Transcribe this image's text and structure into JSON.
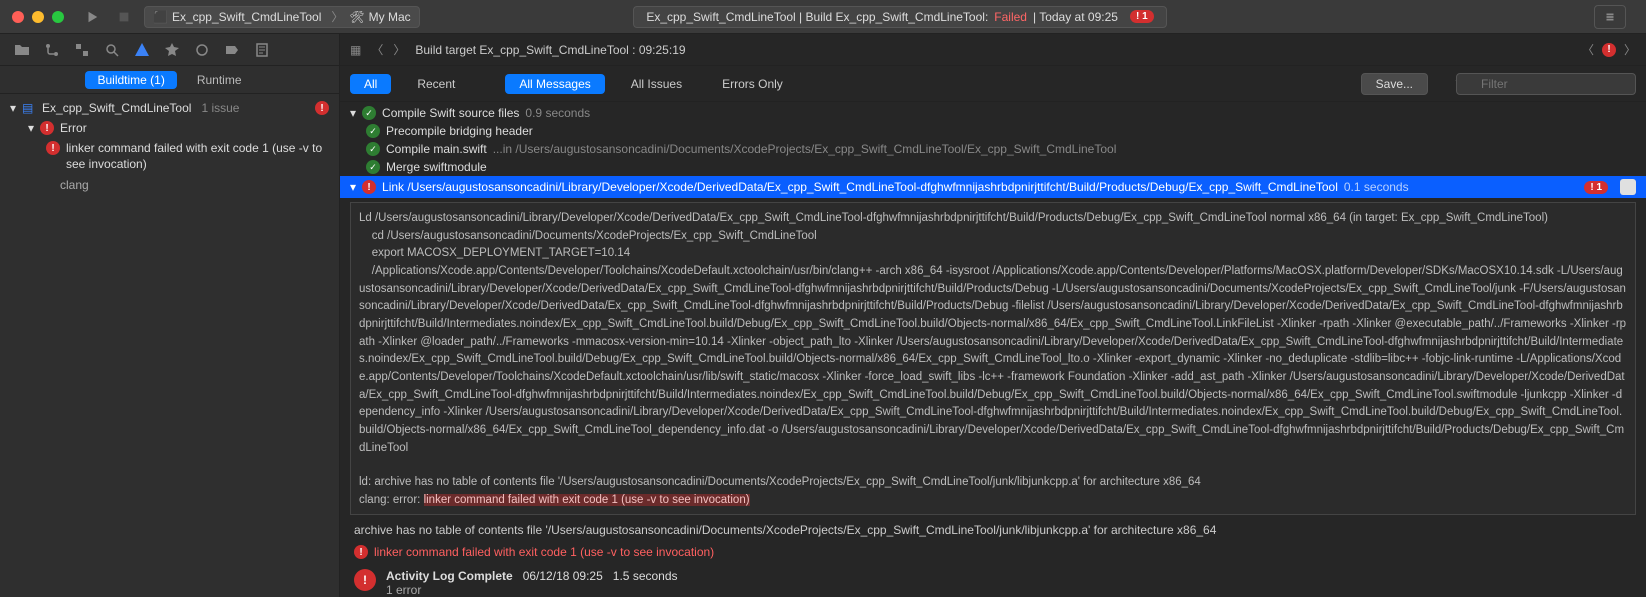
{
  "titlebar": {
    "scheme_app": "Ex_cpp_Swift_CmdLineTool",
    "scheme_dest": "My Mac",
    "status_prefix": "Ex_cpp_Swift_CmdLineTool | Build Ex_cpp_Swift_CmdLineTool:",
    "status_result": "Failed",
    "status_time": "| Today at 09:25",
    "error_count": "1"
  },
  "left": {
    "tab_buildtime": "Buildtime (1)",
    "tab_runtime": "Runtime",
    "project": "Ex_cpp_Swift_CmdLineTool",
    "issue_suffix": "1 issue",
    "error_label": "Error",
    "linker_msg": "linker command failed with exit code 1 (use -v to see invocation)",
    "clang": "clang"
  },
  "crumbs": {
    "target": "Build target Ex_cpp_Swift_CmdLineTool : 09:25:19"
  },
  "filters": {
    "all": "All",
    "recent": "Recent",
    "all_messages": "All Messages",
    "all_issues": "All Issues",
    "errors_only": "Errors Only",
    "save": "Save...",
    "filter_ph": "Filter"
  },
  "log": {
    "compile_header": "Compile Swift source files",
    "compile_time": "0.9 seconds",
    "precompile": "Precompile bridging header",
    "compile_main": "Compile main.swift",
    "compile_main_path": "...in /Users/augustosansoncadini/Documents/XcodeProjects/Ex_cpp_Swift_CmdLineTool/Ex_cpp_Swift_CmdLineTool",
    "merge": "Merge swiftmodule",
    "link_header": "Link /Users/augustosansoncadini/Library/Developer/Xcode/DerivedData/Ex_cpp_Swift_CmdLineTool-dfghwfmnijashrbdpnirjttifcht/Build/Products/Debug/Ex_cpp_Swift_CmdLineTool",
    "link_time": "0.1 seconds",
    "err_badge": "1",
    "code_body": "Ld /Users/augustosansoncadini/Library/Developer/Xcode/DerivedData/Ex_cpp_Swift_CmdLineTool-dfghwfmnijashrbdpnirjttifcht/Build/Products/Debug/Ex_cpp_Swift_CmdLineTool normal x86_64 (in target: Ex_cpp_Swift_CmdLineTool)\n    cd /Users/augustosansoncadini/Documents/XcodeProjects/Ex_cpp_Swift_CmdLineTool\n    export MACOSX_DEPLOYMENT_TARGET=10.14\n    /Applications/Xcode.app/Contents/Developer/Toolchains/XcodeDefault.xctoolchain/usr/bin/clang++ -arch x86_64 -isysroot /Applications/Xcode.app/Contents/Developer/Platforms/MacOSX.platform/Developer/SDKs/MacOSX10.14.sdk -L/Users/augustosansoncadini/Library/Developer/Xcode/DerivedData/Ex_cpp_Swift_CmdLineTool-dfghwfmnijashrbdpnirjttifcht/Build/Products/Debug -L/Users/augustosansoncadini/Documents/XcodeProjects/Ex_cpp_Swift_CmdLineTool/junk -F/Users/augustosansoncadini/Library/Developer/Xcode/DerivedData/Ex_cpp_Swift_CmdLineTool-dfghwfmnijashrbdpnirjttifcht/Build/Products/Debug -filelist /Users/augustosansoncadini/Library/Developer/Xcode/DerivedData/Ex_cpp_Swift_CmdLineTool-dfghwfmnijashrbdpnirjttifcht/Build/Intermediates.noindex/Ex_cpp_Swift_CmdLineTool.build/Debug/Ex_cpp_Swift_CmdLineTool.build/Objects-normal/x86_64/Ex_cpp_Swift_CmdLineTool.LinkFileList -Xlinker -rpath -Xlinker @executable_path/../Frameworks -Xlinker -rpath -Xlinker @loader_path/../Frameworks -mmacosx-version-min=10.14 -Xlinker -object_path_lto -Xlinker /Users/augustosansoncadini/Library/Developer/Xcode/DerivedData/Ex_cpp_Swift_CmdLineTool-dfghwfmnijashrbdpnirjttifcht/Build/Intermediates.noindex/Ex_cpp_Swift_CmdLineTool.build/Debug/Ex_cpp_Swift_CmdLineTool.build/Objects-normal/x86_64/Ex_cpp_Swift_CmdLineTool_lto.o -Xlinker -export_dynamic -Xlinker -no_deduplicate -stdlib=libc++ -fobjc-link-runtime -L/Applications/Xcode.app/Contents/Developer/Toolchains/XcodeDefault.xctoolchain/usr/lib/swift_static/macosx -Xlinker -force_load_swift_libs -lc++ -framework Foundation -Xlinker -add_ast_path -Xlinker /Users/augustosansoncadini/Library/Developer/Xcode/DerivedData/Ex_cpp_Swift_CmdLineTool-dfghwfmnijashrbdpnirjttifcht/Build/Intermediates.noindex/Ex_cpp_Swift_CmdLineTool.build/Debug/Ex_cpp_Swift_CmdLineTool.build/Objects-normal/x86_64/Ex_cpp_Swift_CmdLineTool.swiftmodule -ljunkcpp -Xlinker -dependency_info -Xlinker /Users/augustosansoncadini/Library/Developer/Xcode/DerivedData/Ex_cpp_Swift_CmdLineTool-dfghwfmnijashrbdpnirjttifcht/Build/Intermediates.noindex/Ex_cpp_Swift_CmdLineTool.build/Debug/Ex_cpp_Swift_CmdLineTool.build/Objects-normal/x86_64/Ex_cpp_Swift_CmdLineTool_dependency_info.dat -o /Users/augustosansoncadini/Library/Developer/Xcode/DerivedData/Ex_cpp_Swift_CmdLineTool-dfghwfmnijashrbdpnirjttifcht/Build/Products/Debug/Ex_cpp_Swift_CmdLineTool",
    "code_err1": "ld: archive has no table of contents file '/Users/augustosansoncadini/Documents/XcodeProjects/Ex_cpp_Swift_CmdLineTool/junk/libjunkcpp.a' for architecture x86_64",
    "code_err2_pre": "clang: error: ",
    "code_err2_hl": "linker command failed with exit code 1 (use -v to see invocation)",
    "summary_warn": "archive has no table of contents file '/Users/augustosansoncadini/Documents/XcodeProjects/Ex_cpp_Swift_CmdLineTool/junk/libjunkcpp.a' for architecture x86_64",
    "summary_err": "linker command failed with exit code 1 (use -v to see invocation)",
    "activity": "Activity Log Complete",
    "activity_time": "06/12/18 09:25",
    "activity_dur": "1.5 seconds",
    "activity_sub": "1 error"
  }
}
